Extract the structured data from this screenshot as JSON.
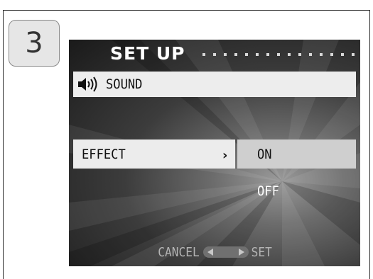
{
  "step": {
    "number": "3"
  },
  "menu": {
    "title": "SET UP",
    "category": {
      "icon": "speaker-icon",
      "label": "SOUND"
    },
    "setting": {
      "label": "EFFECT",
      "arrow": "›"
    },
    "options": [
      {
        "label": "ON",
        "selected": true
      },
      {
        "label": "OFF",
        "selected": false
      }
    ],
    "footer": {
      "cancel_label": "CANCEL",
      "set_label": "SET"
    }
  },
  "colors": {
    "highlight": "#ececec",
    "selected_option": "#cfcfcf",
    "screen_dark": "#1a1a1a"
  }
}
